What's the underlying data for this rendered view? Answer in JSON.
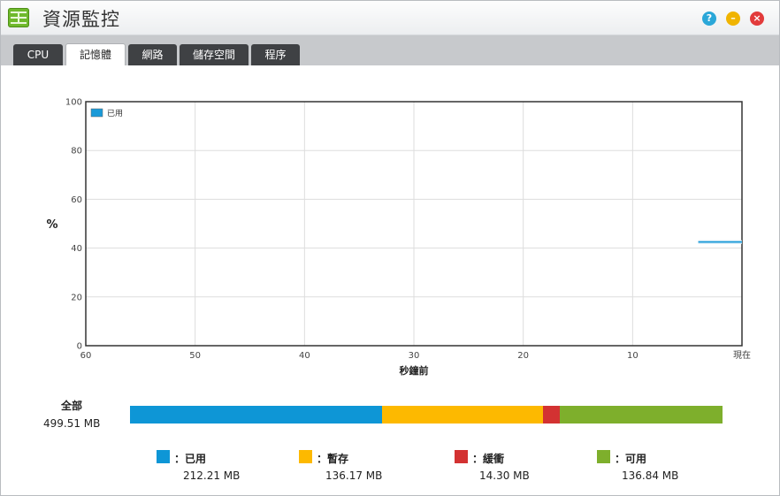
{
  "window": {
    "title": "資源監控"
  },
  "title_buttons": {
    "help": "?",
    "minimize": "–",
    "close": "×"
  },
  "tabs": [
    {
      "label": "CPU",
      "active": false
    },
    {
      "label": "記憶體",
      "active": true
    },
    {
      "label": "網路",
      "active": false
    },
    {
      "label": "儲存空間",
      "active": false
    },
    {
      "label": "程序",
      "active": false
    }
  ],
  "chart_data": {
    "type": "line",
    "ylabel": "%",
    "xlabel": "秒鐘前",
    "ylim": [
      0,
      100
    ],
    "xlim": [
      60,
      0
    ],
    "y_ticks": [
      "0",
      "20",
      "40",
      "60",
      "80",
      "100"
    ],
    "x_ticks": [
      "60",
      "50",
      "40",
      "30",
      "20",
      "10",
      "現在"
    ],
    "grid": true,
    "legend_position": "top-left",
    "series": [
      {
        "name": "已用",
        "color": "#1a9ad8",
        "x": [
          4,
          0
        ],
        "y": [
          42.5,
          42.5
        ]
      }
    ]
  },
  "memory": {
    "total_label": "全部",
    "total_value": "499.51 MB",
    "total_mb": 499.51,
    "segments": [
      {
        "label": "：已用",
        "value": "212.21 MB",
        "mb": 212.21,
        "color": "#0e96d6"
      },
      {
        "label": "：暫存",
        "value": "136.17 MB",
        "mb": 136.17,
        "color": "#fdb900"
      },
      {
        "label": "：緩衝",
        "value": "14.30 MB",
        "mb": 14.3,
        "color": "#d33232"
      },
      {
        "label": "：可用",
        "value": "136.84 MB",
        "mb": 136.84,
        "color": "#7eaf2c"
      }
    ]
  }
}
